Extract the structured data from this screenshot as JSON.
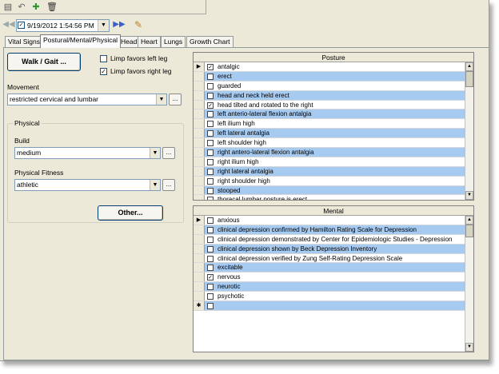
{
  "toolbar": {
    "icons": [
      "save-icon",
      "undo-icon",
      "new-document-icon",
      "delete-icon"
    ],
    "save_glyph": "▤",
    "undo_glyph": "↶",
    "new_glyph": "✚",
    "delete_glyph": "🗑"
  },
  "datetime": {
    "value": "9/19/2012 1:54:56 PM",
    "checked": "✓"
  },
  "nav": {
    "prev_glyph": "◀◀",
    "next_glyph": "▶▶",
    "edit_glyph": "✎"
  },
  "tabs": [
    "Vital Signs",
    "Postural/Mental/Physical",
    "Head",
    "Heart",
    "Lungs",
    "Growth Chart"
  ],
  "active_tab": "Postural/Mental/Physical",
  "left": {
    "walk_button": "Walk / Gait ...",
    "limp_left": {
      "label": "Limp favors left leg",
      "checked": false
    },
    "limp_right": {
      "label": "Limp favors right leg",
      "checked": true
    },
    "movement_label": "Movement",
    "movement_value": "restricted cervical and lumbar",
    "physical_group": "Physical",
    "build_label": "Build",
    "build_value": "medium",
    "fitness_label": "Physical Fitness",
    "fitness_value": "athletic",
    "other_button": "Other...",
    "ellipsis": "...",
    "arrow": "▼"
  },
  "posture": {
    "title": "Posture",
    "rows": [
      {
        "text": "antalgic",
        "checked": true,
        "current": true
      },
      {
        "text": "erect",
        "checked": false
      },
      {
        "text": "guarded",
        "checked": false
      },
      {
        "text": "head and neck held erect",
        "checked": false
      },
      {
        "text": "head tilted and rotated to the right",
        "checked": true
      },
      {
        "text": "left anterio-lateral flexion antalgia",
        "checked": false
      },
      {
        "text": "left ilium high",
        "checked": false
      },
      {
        "text": "left lateral antalgia",
        "checked": false
      },
      {
        "text": "left shoulder high",
        "checked": false
      },
      {
        "text": "right antero-lateral flexion antalgia",
        "checked": false
      },
      {
        "text": "right ilium high",
        "checked": false
      },
      {
        "text": "right lateral antalgia",
        "checked": false
      },
      {
        "text": "right shoulder high",
        "checked": false
      },
      {
        "text": "stooped",
        "checked": false
      },
      {
        "text": "thoracal lumbar posture is erect",
        "checked": false
      }
    ]
  },
  "mental": {
    "title": "Mental",
    "rows": [
      {
        "text": "anxious",
        "checked": false,
        "current": true
      },
      {
        "text": "clinical depression confirmed by Hamilton Rating Scale for Depression",
        "checked": false
      },
      {
        "text": "clinical depression demonstrated by Center for Epidemiologic Studies - Depression",
        "checked": false
      },
      {
        "text": "clinical depression shown by Beck Depression Inventory",
        "checked": false
      },
      {
        "text": "clinical depression verified by Zung Self-Rating Depression Scale",
        "checked": false
      },
      {
        "text": "excitable",
        "checked": false
      },
      {
        "text": "nervous",
        "checked": true
      },
      {
        "text": "neurotic",
        "checked": false
      },
      {
        "text": "psychotic",
        "checked": false
      },
      {
        "text": "",
        "checked": false,
        "new": true
      }
    ]
  },
  "glyphs": {
    "current_row": "▶",
    "new_row": "✱",
    "check": "✓",
    "scroll_up": "▲",
    "scroll_down": "▼"
  }
}
